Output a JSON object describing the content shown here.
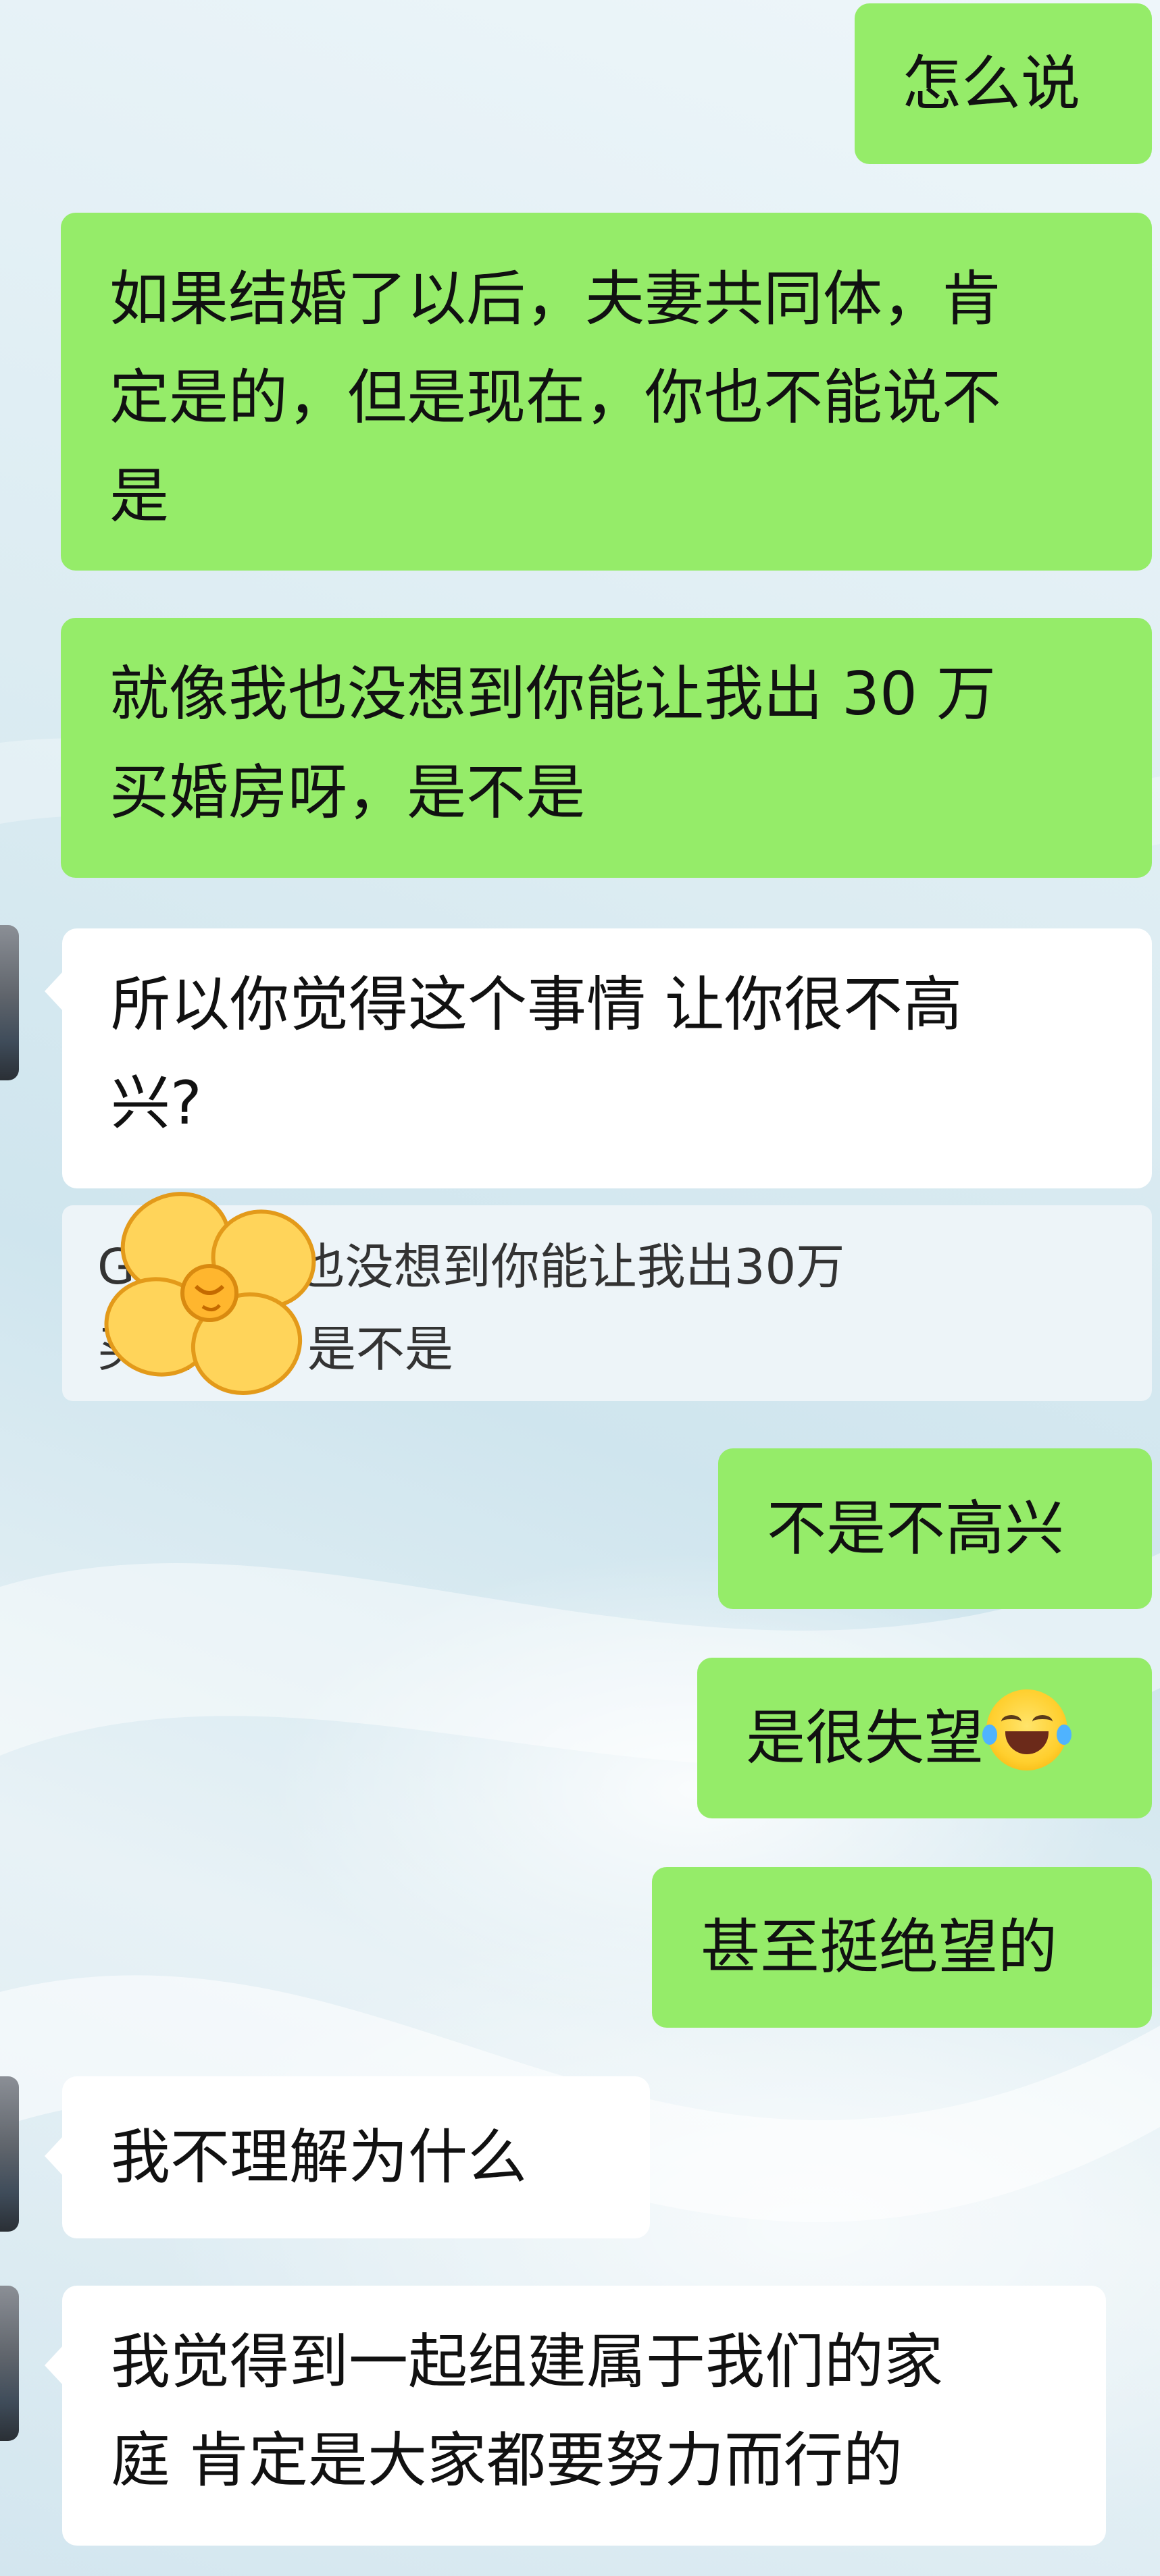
{
  "messages": [
    {
      "id": "m1",
      "side": "right",
      "lines": [
        "怎么说"
      ]
    },
    {
      "id": "m2",
      "side": "right",
      "lines": [
        "如果结婚了以后，夫妻共同体，肯",
        "定是的，但是现在，你也不能说不",
        "是"
      ]
    },
    {
      "id": "m3",
      "side": "right",
      "lines": [
        "就像我也没想到你能让我出 30 万",
        "买婚房呀，是不是"
      ]
    },
    {
      "id": "m4",
      "side": "left",
      "lines": [
        "所以你觉得这个事情 让你很不高",
        "兴?"
      ]
    },
    {
      "id": "m5",
      "side": "right",
      "lines": [
        "不是不高兴"
      ]
    },
    {
      "id": "m6",
      "side": "right",
      "lines": [
        "是很失望"
      ]
    },
    {
      "id": "m7",
      "side": "right",
      "lines": [
        "甚至挺绝望的"
      ]
    },
    {
      "id": "m8",
      "side": "left",
      "lines": [
        "我不理解为什么"
      ]
    },
    {
      "id": "m9",
      "side": "left",
      "lines": [
        "我觉得到一起组建属于我们的家",
        "庭 肯定是大家都要努力而行的"
      ]
    }
  ],
  "quote": {
    "lines": [
      "G        就像我也没想到你能让我出30万",
      "买婚      呀，是不是"
    ]
  },
  "icons": {
    "emoji": "grinning-tears-emoji",
    "sticker": "yellow-flower-sticker"
  },
  "colors": {
    "sent_bubble": "#95ec69",
    "received_bubble": "#ffffff",
    "text": "#111111"
  }
}
